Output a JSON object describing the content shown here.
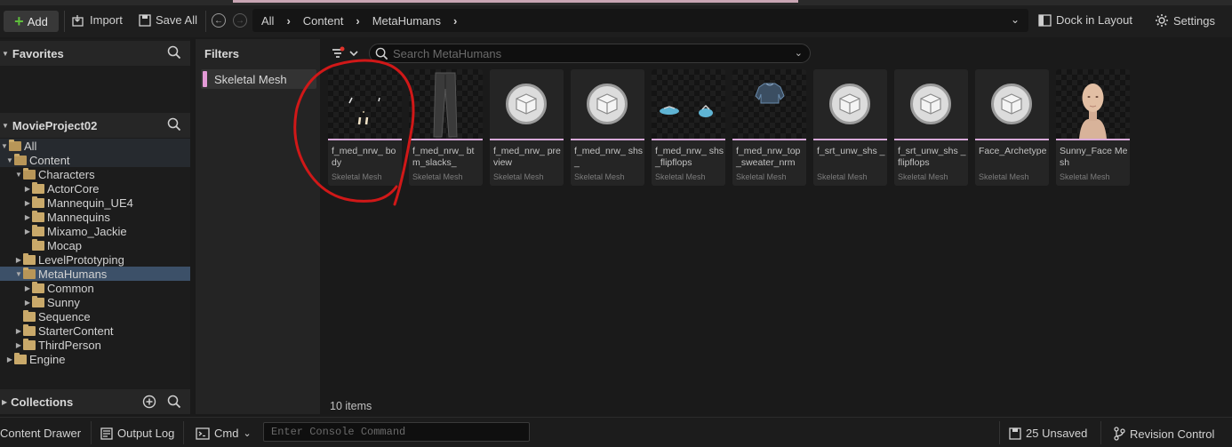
{
  "toolbar": {
    "add_label": "Add",
    "import_label": "Import",
    "save_all_label": "Save All",
    "dock_label": "Dock in Layout",
    "settings_label": "Settings"
  },
  "breadcrumb": [
    "All",
    "Content",
    "MetaHumans"
  ],
  "sidebar": {
    "favorites_title": "Favorites",
    "project_title": "MovieProject02",
    "collections_title": "Collections",
    "tree": [
      {
        "label": "All"
      },
      {
        "label": "Content"
      },
      {
        "label": "Characters"
      },
      {
        "label": "ActorCore"
      },
      {
        "label": "Mannequin_UE4"
      },
      {
        "label": "Mannequins"
      },
      {
        "label": "Mixamo_Jackie"
      },
      {
        "label": "Mocap"
      },
      {
        "label": "LevelPrototyping"
      },
      {
        "label": "MetaHumans"
      },
      {
        "label": "Common"
      },
      {
        "label": "Sunny"
      },
      {
        "label": "Sequence"
      },
      {
        "label": "StarterContent"
      },
      {
        "label": "ThirdPerson"
      },
      {
        "label": "Engine"
      }
    ]
  },
  "filters": {
    "title": "Filters",
    "active_filter": "Skeletal Mesh"
  },
  "search": {
    "placeholder": "Search MetaHumans"
  },
  "assets": [
    {
      "name": "f_med_nrw_ body",
      "type": "Skeletal Mesh",
      "thumb": "body"
    },
    {
      "name": "f_med_nrw_ btm_slacks_",
      "type": "Skeletal Mesh",
      "thumb": "pants"
    },
    {
      "name": "f_med_nrw_ preview",
      "type": "Skeletal Mesh",
      "thumb": "cube"
    },
    {
      "name": "f_med_nrw_ shs_",
      "type": "Skeletal Mesh",
      "thumb": "cube"
    },
    {
      "name": "f_med_nrw_ shs_flipflops",
      "type": "Skeletal Mesh",
      "thumb": "flipflops"
    },
    {
      "name": "f_med_nrw_top _sweater_nrm",
      "type": "Skeletal Mesh",
      "thumb": "sweater"
    },
    {
      "name": "f_srt_unw_shs _",
      "type": "Skeletal Mesh",
      "thumb": "cube"
    },
    {
      "name": "f_srt_unw_shs _flipflops",
      "type": "Skeletal Mesh",
      "thumb": "cube"
    },
    {
      "name": "Face_Archetype",
      "type": "Skeletal Mesh",
      "thumb": "cube"
    },
    {
      "name": "Sunny_Face Mesh",
      "type": "Skeletal Mesh",
      "thumb": "face"
    }
  ],
  "items_count": "10 items",
  "statusbar": {
    "content_drawer": "Content Drawer",
    "output_log": "Output Log",
    "cmd": "Cmd",
    "console_placeholder": "Enter Console Command",
    "unsaved": "25 Unsaved",
    "revision_control": "Revision Control"
  },
  "colors": {
    "accent_skeletal_mesh": "#d8a9d9",
    "selection": "#3c5068",
    "add_plus": "#5fbf3c",
    "annotation": "#d01818"
  }
}
